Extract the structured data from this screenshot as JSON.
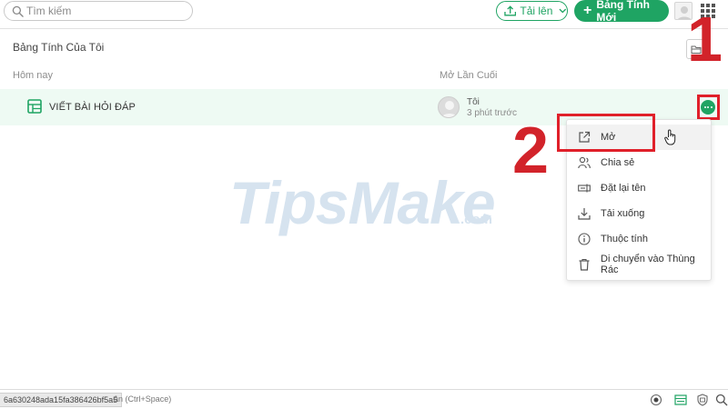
{
  "topbar": {
    "search_placeholder": "Tìm kiếm",
    "upload_label": "Tải lên",
    "new_sheet_label": "Bảng Tính Mới"
  },
  "page": {
    "title": "Bảng Tính Của Tôi",
    "col_today": "Hôm nay",
    "col_last_opened": "Mở Lần Cuối"
  },
  "row": {
    "name": "VIẾT BÀI HỎI ĐÁP",
    "owner": "Tôi",
    "time": "3 phút trước"
  },
  "menu": {
    "items": [
      {
        "label": "Mở",
        "icon": "open-external-icon"
      },
      {
        "label": "Chia sẻ",
        "icon": "share-people-icon"
      },
      {
        "label": "Đặt lại tên",
        "icon": "rename-icon"
      },
      {
        "label": "Tải xuống",
        "icon": "download-icon"
      },
      {
        "label": "Thuộc tính",
        "icon": "info-icon"
      },
      {
        "label": "Di chuyển vào Thùng Rác",
        "icon": "trash-icon"
      }
    ]
  },
  "callouts": {
    "step1": "1",
    "step2": "2"
  },
  "watermark": "TipsMake.com",
  "statusbar": {
    "url": "6a630248ada15fa386426bf5a5",
    "hint": "ản (Ctrl+Space)"
  },
  "colors": {
    "accent": "#1fa463",
    "row_highlight": "#eefaf3",
    "callout": "#e0202a"
  }
}
